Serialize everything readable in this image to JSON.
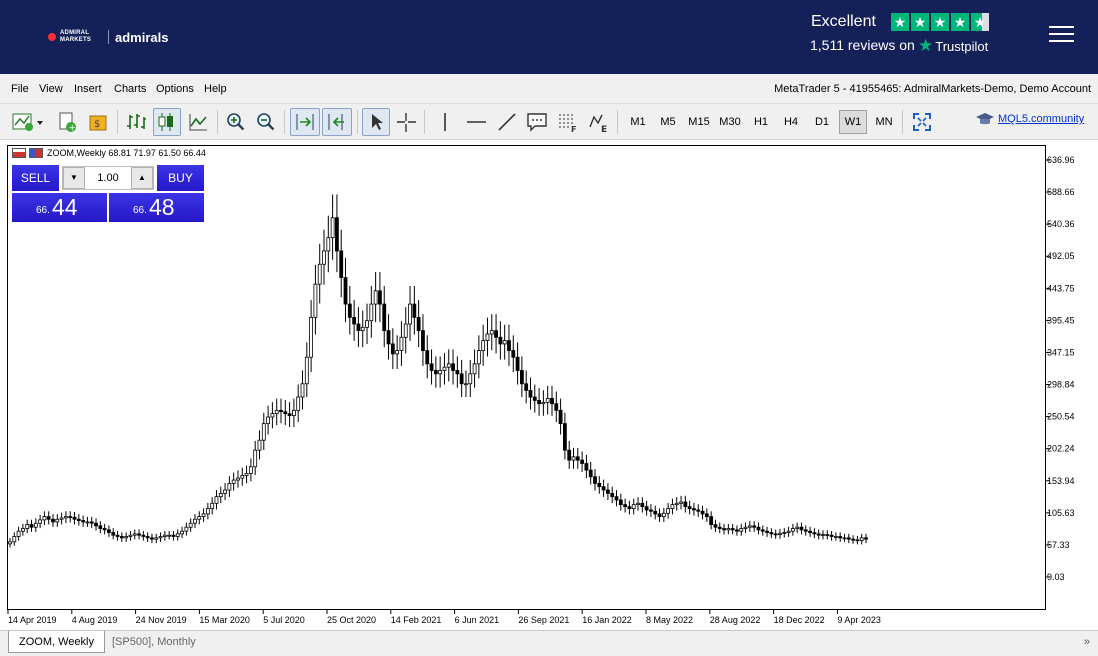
{
  "banner": {
    "logo_small": "ADMIRAL\nMARKETS",
    "logo_word": "admirals",
    "rating_label": "Excellent",
    "reviews_text": "1,511 reviews on",
    "trustpilot_label": "Trustpilot",
    "trustpilot_stars": 4.5,
    "star_color": "#00b67a",
    "background": "#142159"
  },
  "menu": {
    "items": [
      "File",
      "View",
      "Insert",
      "Charts",
      "Options",
      "Help"
    ],
    "account": "MetaTrader 5 - 41955465: AdmiralMarkets-Demo, Demo Account"
  },
  "toolbar": {
    "timeframes": [
      "M1",
      "M5",
      "M15",
      "M30",
      "H1",
      "H4",
      "D1",
      "W1",
      "MN"
    ],
    "active_timeframe": "W1",
    "mql_link": "MQL5.community"
  },
  "chart": {
    "symbol_info": "ZOOM,Weekly  68.81 71.97 61.50 66.44",
    "trade": {
      "sell_label": "SELL",
      "buy_label": "BUY",
      "lot": "1.00",
      "sell_small": "66.",
      "sell_big": "44",
      "buy_small": "66.",
      "buy_big": "48"
    }
  },
  "chart_data": {
    "type": "candlestick",
    "symbol": "ZOOM",
    "timeframe": "Weekly",
    "y_ticks": [
      "636.96",
      "588.66",
      "540.36",
      "492.05",
      "443.75",
      "395.45",
      "347.15",
      "298.84",
      "250.54",
      "202.24",
      "153.94",
      "105.63",
      "57.33",
      "9.03"
    ],
    "ylim": [
      9.03,
      636.96
    ],
    "x_ticks": [
      "14 Apr 2019",
      "4 Aug 2019",
      "24 Nov 2019",
      "15 Mar 2020",
      "5 Jul 2020",
      "25 Oct 2020",
      "14 Feb 2021",
      "6 Jun 2021",
      "26 Sep 2021",
      "16 Jan 2022",
      "8 May 2022",
      "28 Aug 2022",
      "18 Dec 2022",
      "9 Apr 2023"
    ],
    "closes": [
      62,
      70,
      78,
      82,
      88,
      84,
      90,
      95,
      100,
      96,
      92,
      96,
      98,
      100,
      99,
      96,
      94,
      92,
      92,
      90,
      86,
      82,
      80,
      76,
      72,
      70,
      68,
      70,
      72,
      74,
      72,
      70,
      68,
      66,
      68,
      70,
      72,
      72,
      70,
      74,
      78,
      84,
      90,
      96,
      100,
      104,
      112,
      120,
      130,
      135,
      140,
      150,
      155,
      158,
      162,
      165,
      175,
      200,
      215,
      240,
      250,
      255,
      260,
      258,
      255,
      252,
      260,
      280,
      300,
      340,
      400,
      450,
      480,
      500,
      520,
      550,
      500,
      460,
      420,
      400,
      390,
      380,
      385,
      395,
      420,
      440,
      420,
      380,
      360,
      345,
      350,
      370,
      390,
      420,
      400,
      380,
      350,
      330,
      320,
      315,
      320,
      325,
      330,
      320,
      315,
      300,
      300,
      315,
      330,
      350,
      365,
      375,
      380,
      370,
      360,
      365,
      350,
      340,
      320,
      300,
      290,
      280,
      275,
      270,
      272,
      278,
      270,
      260,
      240,
      200,
      185,
      190,
      185,
      180,
      170,
      160,
      150,
      145,
      140,
      135,
      130,
      125,
      118,
      115,
      112,
      118,
      120,
      115,
      110,
      108,
      104,
      100,
      105,
      112,
      118,
      120,
      122,
      115,
      112,
      110,
      108,
      104,
      100,
      88,
      84,
      82,
      80,
      82,
      80,
      78,
      82,
      84,
      86,
      84,
      80,
      78,
      76,
      74,
      73,
      75,
      76,
      78,
      82,
      84,
      80,
      78,
      76,
      74,
      72,
      73,
      72,
      70,
      70,
      68,
      68,
      66,
      65,
      64,
      68,
      66
    ],
    "grid": false
  },
  "tabs": [
    "ZOOM, Weekly",
    "[SP500], Monthly"
  ]
}
